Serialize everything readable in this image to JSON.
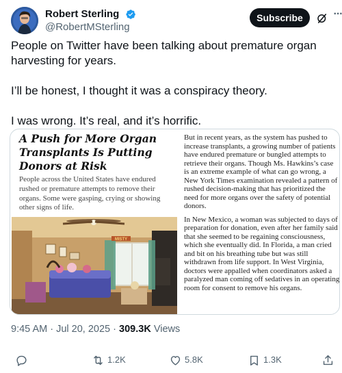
{
  "author": {
    "display_name": "Robert Sterling",
    "handle": "@RobertMSterling",
    "verified": true
  },
  "header": {
    "subscribe_label": "Subscribe",
    "more_icon": "more-icon",
    "grok_icon": "grok-icon"
  },
  "tweet": {
    "paragraphs": [
      "People on Twitter have been talking about premature organ harvesting for years.",
      "I’ll be honest, I thought it was a conspiracy theory.",
      "I was wrong. It’s real, and it’s horrific."
    ]
  },
  "article": {
    "headline": "A Push for More Organ Transplants Is Putting Donors at Risk",
    "dek": "People across the United States have endured rushed or premature attempts to remove their organs. Some were gasping, crying or showing other signs of life.",
    "photo_sign": "MISTY",
    "body": [
      "But in recent years, as the system has pushed to increase transplants, a growing number of patients have endured premature or bungled attempts to retrieve their organs. Though Ms. Hawkins’s case is an extreme example of what can go wrong, a New York Times examination revealed a pattern of rushed decision-making that has prioritized the need for more organs over the safety of potential donors.",
      "In New Mexico, a woman was subjected to days of preparation for donation, even after her family said that she seemed to be regaining consciousness, which she eventually did. In Florida, a man cried and bit on his breathing tube but was still withdrawn from life support. In West Virginia, doctors were appalled when coordinators asked a paralyzed man coming off sedatives in an operating room for consent to remove his organs."
    ]
  },
  "meta": {
    "time": "9:45 AM",
    "separator": "·",
    "date": "Jul 20, 2025",
    "views_count": "309.3K",
    "views_label": "Views"
  },
  "actions": {
    "reply_count": "",
    "retweet_count": "1.2K",
    "like_count": "5.8K",
    "bookmark_count": "1.3K"
  },
  "colors": {
    "text": "#0f1419",
    "secondary": "#536471",
    "verified_blue": "#1d9bf0",
    "border": "#cfd9de"
  }
}
